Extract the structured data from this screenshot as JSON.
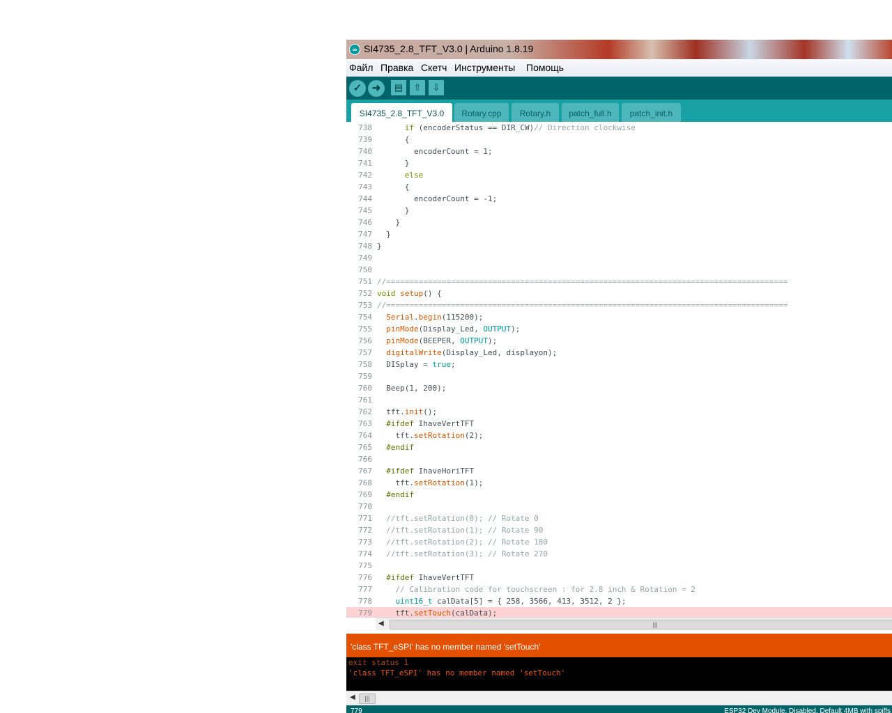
{
  "window": {
    "title": "SI4735_2.8_TFT_V3.0 | Arduino 1.8.19",
    "logo_icon": "arduino-logo-icon"
  },
  "menu": [
    "Файл",
    "Правка",
    "Скетч",
    "Инструменты",
    "Помощь"
  ],
  "toolbar": {
    "buttons": [
      {
        "name": "verify",
        "icon": "check-icon",
        "glyph": "✓"
      },
      {
        "name": "upload",
        "icon": "arrow-right-icon",
        "glyph": "➜"
      },
      {
        "name": "new",
        "icon": "new-file-icon",
        "glyph": "▤"
      },
      {
        "name": "open",
        "icon": "arrow-up-icon",
        "glyph": "⇧"
      },
      {
        "name": "save",
        "icon": "arrow-down-icon",
        "glyph": "⇩"
      }
    ]
  },
  "tabs": [
    "SI4735_2.8_TFT_V3.0",
    "Rotary.cpp",
    "Rotary.h",
    "patch_full.h",
    "patch_init.h"
  ],
  "active_tab": "SI4735_2.8_TFT_V3.0",
  "editor": {
    "lines": [
      {
        "n": "738",
        "t": "      if (encoderStatus == DIR_CW)// Direction clockwise"
      },
      {
        "n": "739",
        "t": "      {"
      },
      {
        "n": "740",
        "t": "        encoderCount = 1;"
      },
      {
        "n": "741",
        "t": "      }"
      },
      {
        "n": "742",
        "t": "      else"
      },
      {
        "n": "743",
        "t": "      {"
      },
      {
        "n": "744",
        "t": "        encoderCount = -1;"
      },
      {
        "n": "745",
        "t": "      }"
      },
      {
        "n": "746",
        "t": "    }"
      },
      {
        "n": "747",
        "t": "  }"
      },
      {
        "n": "748",
        "t": "}"
      },
      {
        "n": "749",
        "t": ""
      },
      {
        "n": "750",
        "t": ""
      },
      {
        "n": "751",
        "t": "//======================================================================================="
      },
      {
        "n": "752",
        "t": "void setup() {"
      },
      {
        "n": "753",
        "t": "//======================================================================================="
      },
      {
        "n": "754",
        "t": "  Serial.begin(115200);"
      },
      {
        "n": "755",
        "t": "  pinMode(Display_Led, OUTPUT);"
      },
      {
        "n": "756",
        "t": "  pinMode(BEEPER, OUTPUT);"
      },
      {
        "n": "757",
        "t": "  digitalWrite(Display_Led, displayon);"
      },
      {
        "n": "758",
        "t": "  DISplay = true;"
      },
      {
        "n": "759",
        "t": ""
      },
      {
        "n": "760",
        "t": "  Beep(1, 200);"
      },
      {
        "n": "761",
        "t": ""
      },
      {
        "n": "762",
        "t": "  tft.init();"
      },
      {
        "n": "763",
        "t": "  #ifdef IhaveVertTFT"
      },
      {
        "n": "764",
        "t": "    tft.setRotation(2);"
      },
      {
        "n": "765",
        "t": "  #endif"
      },
      {
        "n": "766",
        "t": ""
      },
      {
        "n": "767",
        "t": "  #ifdef IhaveHoriTFT"
      },
      {
        "n": "768",
        "t": "    tft.setRotation(1);"
      },
      {
        "n": "769",
        "t": "  #endif"
      },
      {
        "n": "770",
        "t": ""
      },
      {
        "n": "771",
        "t": "  //tft.setRotation(0); // Rotate 0"
      },
      {
        "n": "772",
        "t": "  //tft.setRotation(1); // Rotate 90"
      },
      {
        "n": "773",
        "t": "  //tft.setRotation(2); // Rotate 180"
      },
      {
        "n": "774",
        "t": "  //tft.setRotation(3); // Rotate 270"
      },
      {
        "n": "775",
        "t": ""
      },
      {
        "n": "776",
        "t": "  #ifdef IhaveVertTFT"
      },
      {
        "n": "777",
        "t": "    // Calibration code for touchscreen : for 2.8 inch & Rotation = 2"
      },
      {
        "n": "778",
        "t": "    uint16_t calData[5] = { 258, 3566, 413, 3512, 2 };"
      },
      {
        "n": "779",
        "t": "    tft.setTouch(calData);",
        "error": true
      }
    ]
  },
  "error_message": "'class TFT_eSPI' has no member named 'setTouch'",
  "console": [
    "exit status 1",
    "'class TFT_eSPI' has no member named 'setTouch'"
  ],
  "status": {
    "line": "779",
    "board": "ESP32 Dev Module, Disabled, Default 4MB with spiffs"
  },
  "colors": {
    "teal_dark": "#006468",
    "teal_tabs": "#17a1a5",
    "error_bar": "#e35100",
    "error_line": "#ffd3d3"
  }
}
